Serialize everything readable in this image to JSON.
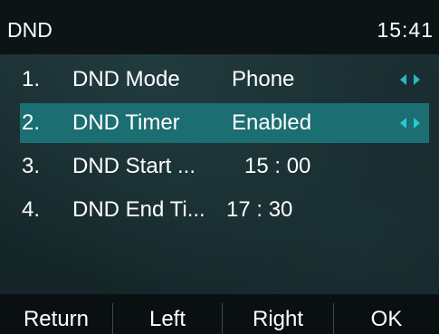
{
  "header": {
    "title": "DND",
    "time": "15:41"
  },
  "menu": {
    "items": [
      {
        "number": "1.",
        "label": "DND Mode",
        "value": "Phone",
        "has_arrows": true,
        "selected": false
      },
      {
        "number": "2.",
        "label": "DND Timer",
        "value": "Enabled",
        "has_arrows": true,
        "selected": true
      },
      {
        "number": "3.",
        "label": "DND Start ...",
        "value": "15 : 00",
        "has_arrows": false,
        "selected": false
      },
      {
        "number": "4.",
        "label": "DND End Ti...",
        "value": "17 : 30",
        "has_arrows": false,
        "selected": false
      }
    ]
  },
  "softkeys": {
    "return": "Return",
    "left": "Left",
    "right": "Right",
    "ok": "OK"
  },
  "colors": {
    "highlight": "#1b6e72",
    "arrow": "#27b8c6",
    "titlebar": "#0c1416",
    "softkey_bar": "#0a1011"
  }
}
